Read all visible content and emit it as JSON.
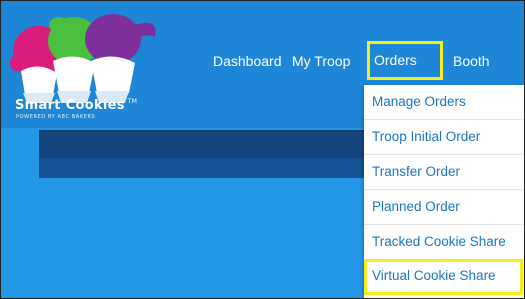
{
  "brand": {
    "name": "Smart Cookies",
    "tm": "TM",
    "tagline": "POWERED BY ABC BAKERS"
  },
  "nav": {
    "dashboard": "Dashboard",
    "my_troop": "My Troop",
    "orders": "Orders",
    "booth": "Booth"
  },
  "orders_menu": {
    "items": [
      "Manage Orders",
      "Troop Initial Order",
      "Transfer Order",
      "Planned Order",
      "Tracked Cookie Share",
      "Virtual Cookie Share"
    ],
    "highlighted_item": "Virtual Cookie Share"
  },
  "colors": {
    "header_bg": "#1d86d6",
    "content_bg": "#2397e6",
    "panel_bg": "#13447d",
    "highlight_border": "#f6ee1c",
    "menu_link": "#1a76c2"
  }
}
